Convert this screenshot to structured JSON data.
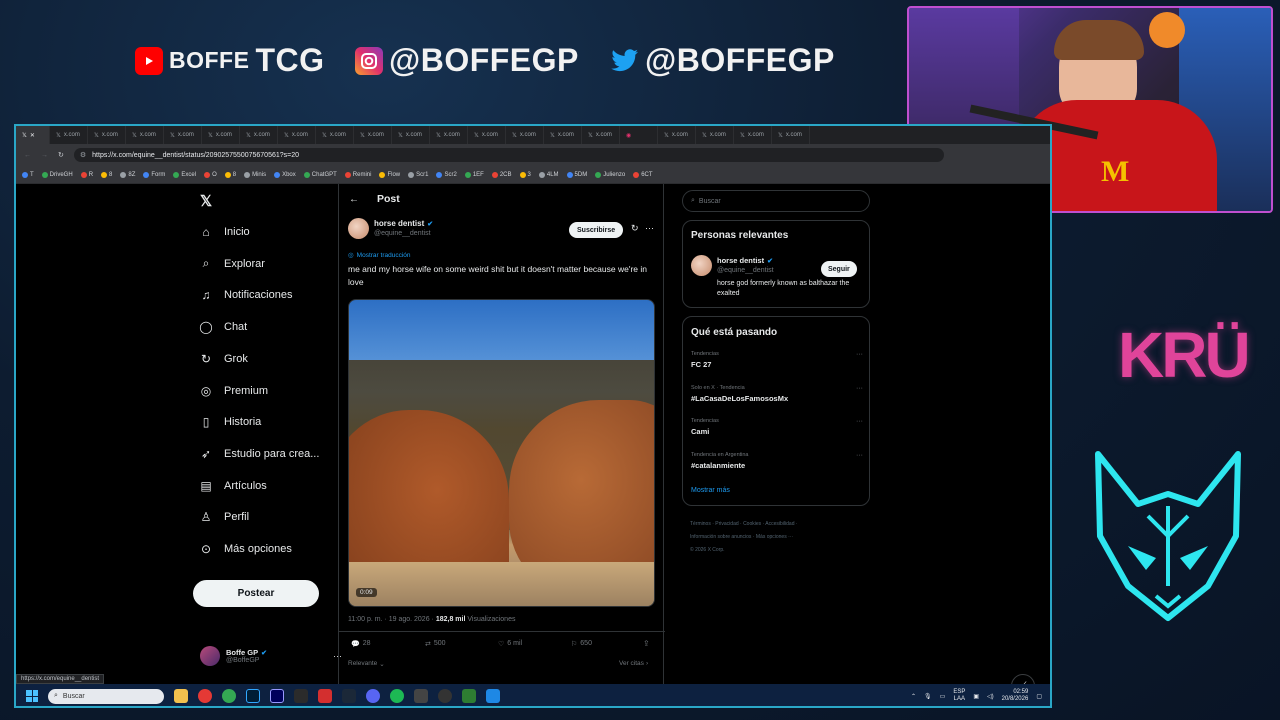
{
  "overlay": {
    "youtube_prefix": "BOFFE",
    "youtube_name": "TCG",
    "instagram_handle": "@BOFFEGP",
    "twitter_handle": "@BOFFEGP",
    "brand_logo_text": "KRÜ"
  },
  "browser": {
    "tab_label": "x.com",
    "url": "https://x.com/equine__dentist/status/2090257550075670561?s=20",
    "bookmarks": [
      "T",
      "DriveGH",
      "R",
      "8",
      "8Z",
      "Form",
      "Excel",
      "O",
      "8",
      "Minis",
      "Xbox",
      "ChatGPT",
      "Remini",
      "Flow",
      "Scr1",
      "Scr2",
      "1EF",
      "2CB",
      "3",
      "4LM",
      "5DM",
      "Julienzo",
      "6CT"
    ],
    "status_url": "https://x.com/equine__dentist"
  },
  "nav": {
    "items": [
      {
        "label": "Inicio",
        "icon": "home-icon"
      },
      {
        "label": "Explorar",
        "icon": "search-icon"
      },
      {
        "label": "Notificaciones",
        "icon": "bell-icon"
      },
      {
        "label": "Chat",
        "icon": "chat-icon"
      },
      {
        "label": "Grok",
        "icon": "grok-icon"
      },
      {
        "label": "Premium",
        "icon": "premium-icon"
      },
      {
        "label": "Historia",
        "icon": "history-icon"
      },
      {
        "label": "Estudio para crea...",
        "icon": "rocket-icon"
      },
      {
        "label": "Artículos",
        "icon": "article-icon"
      },
      {
        "label": "Perfil",
        "icon": "profile-icon"
      },
      {
        "label": "Más opciones",
        "icon": "more-icon"
      }
    ],
    "post_button": "Postear",
    "account_name": "Boffe GP",
    "account_handle": "@BoffeGP"
  },
  "post": {
    "header": "Post",
    "author_name": "horse dentist",
    "author_handle": "@equine__dentist",
    "subscribe_label": "Suscribirse",
    "translate_label": "Mostrar traducción",
    "text": "me and my horse wife on some weird shit but it doesn't matter because we're in love",
    "video_time": "0:09",
    "meta_time": "11:00 p. m. · 19 ago. 2026 · ",
    "views_count": "182,8 mil",
    "views_label": " Visualizaciones",
    "replies": "28",
    "reposts": "500",
    "likes": "6 mil",
    "bookmarks": "650",
    "sort_label": "Relevante",
    "quotes_label": "Ver citas"
  },
  "sidebar": {
    "search_placeholder": "Buscar",
    "relevant_title": "Personas relevantes",
    "relevant_name": "horse dentist",
    "relevant_handle": "@equine__dentist",
    "follow_label": "Seguir",
    "relevant_bio": "horse god formerly known as balthazar the exalted",
    "trending_title": "Qué está pasando",
    "trends": [
      {
        "category": "Tendencias",
        "title": "FC 27"
      },
      {
        "category": "Solo en X · Tendencia",
        "title": "#LaCasaDeLosFamososMx"
      },
      {
        "category": "Tendencias",
        "title": "Cami"
      },
      {
        "category": "Tendencia en Argentina",
        "title": "#catalanmiente"
      }
    ],
    "show_more": "Mostrar más",
    "footer_line1": "Términos · Privacidad · Cookies · Accesibilidad ·",
    "footer_line2": "Información sobre anuncios · Más opciones ···",
    "footer_line3": "© 2026 X Corp."
  },
  "taskbar": {
    "search_label": "Buscar",
    "lang_top": "ESP",
    "lang_bottom": "LAA",
    "time": "02:59",
    "date": "20/8/2026"
  },
  "colors": {
    "accent": "#1d9bf0",
    "frame": "#2aa7c7",
    "cam_border": "#c04fd0",
    "kru_pink": "#e0449a",
    "fox_cyan": "#2ee6ef"
  }
}
